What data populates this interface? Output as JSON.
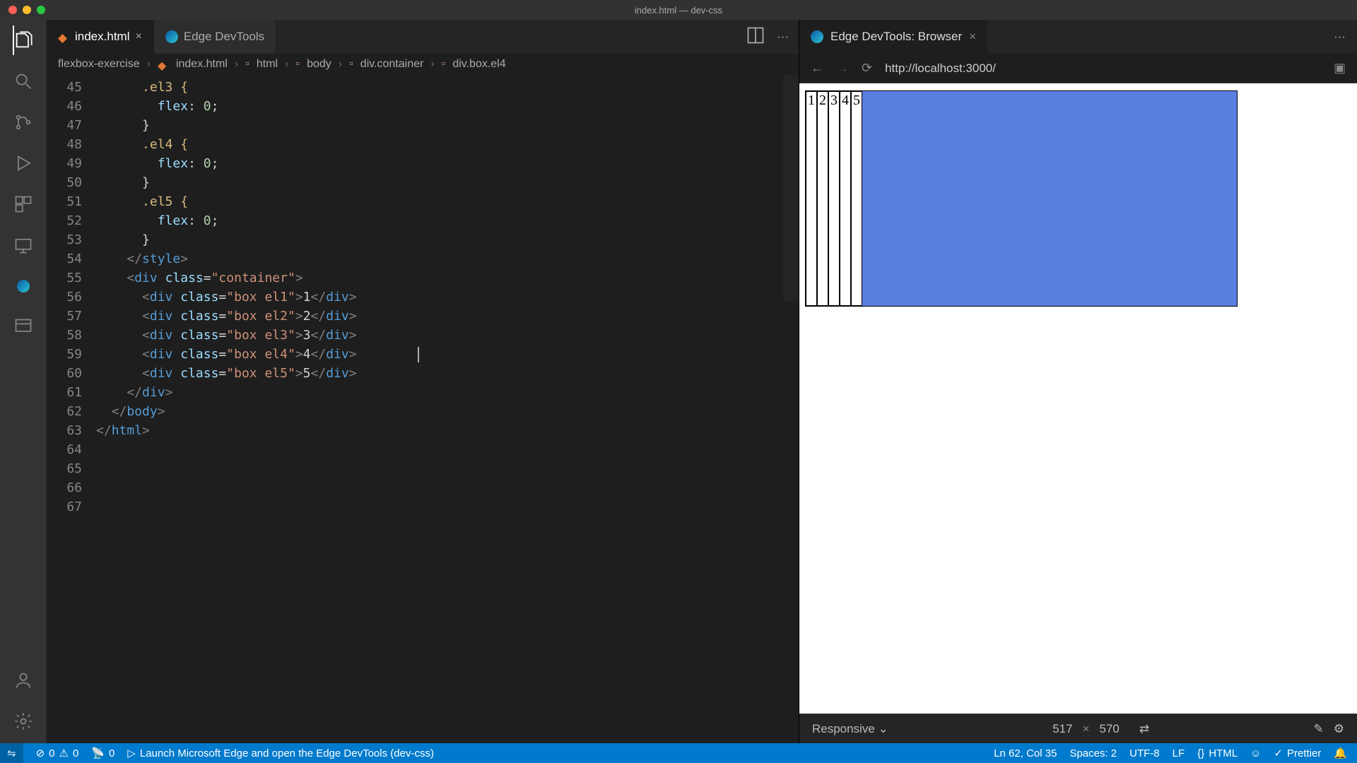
{
  "window": {
    "title": "index.html — dev-css"
  },
  "tabs": {
    "file": {
      "label": "index.html"
    },
    "devtools": {
      "label": "Edge DevTools"
    }
  },
  "breadcrumbs": {
    "project": "flexbox-exercise",
    "file": "index.html",
    "path": [
      "html",
      "body",
      "div.container",
      "div.box.el4"
    ]
  },
  "code": {
    "lines": [
      {
        "n": 45,
        "seg": [
          {
            "ind": 3
          },
          {
            "t": ".el3 {",
            "c": "sel"
          }
        ]
      },
      {
        "n": 46,
        "seg": [
          {
            "ind": 4
          },
          {
            "t": "flex",
            "c": "prop"
          },
          {
            "t": ": ",
            "c": "punc"
          },
          {
            "t": "0",
            "c": "num"
          },
          {
            "t": ";",
            "c": "punc"
          }
        ]
      },
      {
        "n": 47,
        "seg": [
          {
            "ind": 3
          },
          {
            "t": "}",
            "c": "punc"
          }
        ]
      },
      {
        "n": 48,
        "seg": [
          {
            "ind": 0
          }
        ]
      },
      {
        "n": 49,
        "seg": [
          {
            "ind": 3
          },
          {
            "t": ".el4 {",
            "c": "sel"
          }
        ]
      },
      {
        "n": 50,
        "seg": [
          {
            "ind": 4
          },
          {
            "t": "flex",
            "c": "prop"
          },
          {
            "t": ": ",
            "c": "punc"
          },
          {
            "t": "0",
            "c": "num"
          },
          {
            "t": ";",
            "c": "punc"
          }
        ]
      },
      {
        "n": 51,
        "seg": [
          {
            "ind": 3
          },
          {
            "t": "}",
            "c": "punc"
          }
        ]
      },
      {
        "n": 52,
        "seg": [
          {
            "ind": 0
          }
        ]
      },
      {
        "n": 53,
        "seg": [
          {
            "ind": 3
          },
          {
            "t": ".el5 {",
            "c": "sel"
          }
        ]
      },
      {
        "n": 54,
        "seg": [
          {
            "ind": 4
          },
          {
            "t": "flex",
            "c": "prop"
          },
          {
            "t": ": ",
            "c": "punc"
          },
          {
            "t": "0",
            "c": "num"
          },
          {
            "t": ";",
            "c": "punc"
          }
        ]
      },
      {
        "n": 55,
        "seg": [
          {
            "ind": 3
          },
          {
            "t": "}",
            "c": "punc"
          }
        ]
      },
      {
        "n": 56,
        "seg": [
          {
            "ind": 2
          },
          {
            "t": "</",
            "c": "br"
          },
          {
            "t": "style",
            "c": "tag"
          },
          {
            "t": ">",
            "c": "br"
          }
        ]
      },
      {
        "n": 57,
        "seg": [
          {
            "ind": 0
          }
        ]
      },
      {
        "n": 58,
        "seg": [
          {
            "ind": 2
          },
          {
            "t": "<",
            "c": "br"
          },
          {
            "t": "div ",
            "c": "tag"
          },
          {
            "t": "class",
            "c": "attr"
          },
          {
            "t": "=",
            "c": "punc"
          },
          {
            "t": "\"container\"",
            "c": "str"
          },
          {
            "t": ">",
            "c": "br"
          }
        ]
      },
      {
        "n": 59,
        "seg": [
          {
            "ind": 3
          },
          {
            "t": "<",
            "c": "br"
          },
          {
            "t": "div ",
            "c": "tag"
          },
          {
            "t": "class",
            "c": "attr"
          },
          {
            "t": "=",
            "c": "punc"
          },
          {
            "t": "\"box el1\"",
            "c": "str"
          },
          {
            "t": ">",
            "c": "br"
          },
          {
            "t": "1",
            "c": "punc"
          },
          {
            "t": "</",
            "c": "br"
          },
          {
            "t": "div",
            "c": "tag"
          },
          {
            "t": ">",
            "c": "br"
          }
        ]
      },
      {
        "n": 60,
        "seg": [
          {
            "ind": 3
          },
          {
            "t": "<",
            "c": "br"
          },
          {
            "t": "div ",
            "c": "tag"
          },
          {
            "t": "class",
            "c": "attr"
          },
          {
            "t": "=",
            "c": "punc"
          },
          {
            "t": "\"box el2\"",
            "c": "str"
          },
          {
            "t": ">",
            "c": "br"
          },
          {
            "t": "2",
            "c": "punc"
          },
          {
            "t": "</",
            "c": "br"
          },
          {
            "t": "div",
            "c": "tag"
          },
          {
            "t": ">",
            "c": "br"
          }
        ]
      },
      {
        "n": 61,
        "seg": [
          {
            "ind": 3
          },
          {
            "t": "<",
            "c": "br"
          },
          {
            "t": "div ",
            "c": "tag"
          },
          {
            "t": "class",
            "c": "attr"
          },
          {
            "t": "=",
            "c": "punc"
          },
          {
            "t": "\"box el3\"",
            "c": "str"
          },
          {
            "t": ">",
            "c": "br"
          },
          {
            "t": "3",
            "c": "punc"
          },
          {
            "t": "</",
            "c": "br"
          },
          {
            "t": "div",
            "c": "tag"
          },
          {
            "t": ">",
            "c": "br"
          }
        ]
      },
      {
        "n": 62,
        "seg": [
          {
            "ind": 3
          },
          {
            "t": "<",
            "c": "br"
          },
          {
            "t": "div ",
            "c": "tag"
          },
          {
            "t": "class",
            "c": "attr"
          },
          {
            "t": "=",
            "c": "punc"
          },
          {
            "t": "\"box el4\"",
            "c": "str"
          },
          {
            "t": ">",
            "c": "br"
          },
          {
            "t": "4",
            "c": "punc"
          },
          {
            "t": "</",
            "c": "br"
          },
          {
            "t": "div",
            "c": "tag"
          },
          {
            "t": ">",
            "c": "br"
          }
        ],
        "cursor": true
      },
      {
        "n": 63,
        "seg": [
          {
            "ind": 3
          },
          {
            "t": "<",
            "c": "br"
          },
          {
            "t": "div ",
            "c": "tag"
          },
          {
            "t": "class",
            "c": "attr"
          },
          {
            "t": "=",
            "c": "punc"
          },
          {
            "t": "\"box el5\"",
            "c": "str"
          },
          {
            "t": ">",
            "c": "br"
          },
          {
            "t": "5",
            "c": "punc"
          },
          {
            "t": "</",
            "c": "br"
          },
          {
            "t": "div",
            "c": "tag"
          },
          {
            "t": ">",
            "c": "br"
          }
        ]
      },
      {
        "n": 64,
        "seg": [
          {
            "ind": 2
          },
          {
            "t": "</",
            "c": "br"
          },
          {
            "t": "div",
            "c": "tag"
          },
          {
            "t": ">",
            "c": "br"
          }
        ]
      },
      {
        "n": 65,
        "seg": [
          {
            "ind": 1
          },
          {
            "t": "</",
            "c": "br"
          },
          {
            "t": "body",
            "c": "tag"
          },
          {
            "t": ">",
            "c": "br"
          }
        ]
      },
      {
        "n": 66,
        "seg": [
          {
            "ind": 0
          },
          {
            "t": "</",
            "c": "br"
          },
          {
            "t": "html",
            "c": "tag"
          },
          {
            "t": ">",
            "c": "br"
          }
        ]
      },
      {
        "n": 67,
        "seg": [
          {
            "ind": 0
          }
        ]
      }
    ]
  },
  "devtools": {
    "tab_label": "Edge DevTools: Browser",
    "url": "http://localhost:3000/",
    "device": "Responsive",
    "width": "517",
    "height": "570",
    "boxes": [
      "1",
      "2",
      "3",
      "4",
      "5"
    ]
  },
  "status": {
    "errors": "0",
    "warnings": "0",
    "ports": "0",
    "launch": "Launch Microsoft Edge and open the Edge DevTools (dev-css)",
    "cursor": "Ln 62, Col 35",
    "indent": "Spaces: 2",
    "encoding": "UTF-8",
    "eol": "LF",
    "lang": "HTML",
    "prettier": "Prettier"
  }
}
